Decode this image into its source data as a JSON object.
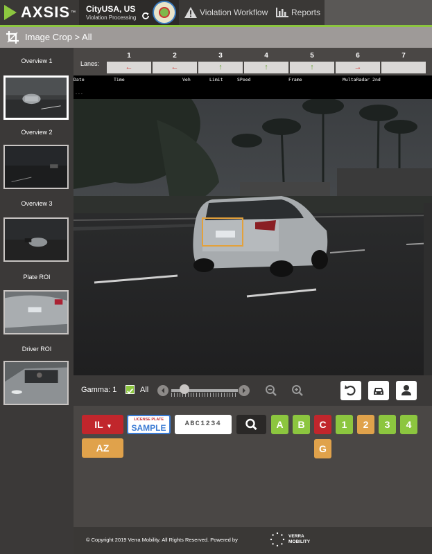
{
  "header": {
    "logo_text": "AXSIS",
    "logo_tm": "™",
    "city": "CityUSA, US",
    "city_sub": "Violation Processing",
    "nav": [
      {
        "label": "Violation Workflow",
        "icon": "warning-icon"
      },
      {
        "label": "Reports",
        "icon": "bar-chart-icon"
      }
    ]
  },
  "subheader": {
    "title": "Image Crop > All",
    "icon": "crop-icon"
  },
  "sidebar": {
    "thumbnails": [
      {
        "label": "Overview 1",
        "selected": true
      },
      {
        "label": "Overview 2",
        "selected": false
      },
      {
        "label": "Overview 3",
        "selected": false
      },
      {
        "label": "Plate ROI",
        "selected": false
      },
      {
        "label": "Driver ROI",
        "selected": false
      }
    ]
  },
  "lanes": {
    "label": "Lanes:",
    "items": [
      {
        "num": "1",
        "arrow": "←",
        "color": "#d0302b"
      },
      {
        "num": "2",
        "arrow": "←",
        "color": "#d0302b"
      },
      {
        "num": "3",
        "arrow": "↑",
        "color": "#6aa336"
      },
      {
        "num": "4",
        "arrow": "↑",
        "color": "#6aa336"
      },
      {
        "num": "5",
        "arrow": "↑",
        "color": "#6aa336"
      },
      {
        "num": "6",
        "arrow": "→",
        "color": "#d0302b"
      },
      {
        "num": "7",
        "arrow": "",
        "color": ""
      }
    ]
  },
  "data_strip": {
    "headers": [
      "Date",
      "Time",
      "Veh",
      "Limit",
      "SPeed",
      "Frame",
      "MultaRadar 2nd"
    ],
    "dash": "---"
  },
  "controls": {
    "gamma_label": "Gamma: 1",
    "all_label": "All",
    "all_checked": true,
    "gamma_level": 0.2
  },
  "plate": {
    "state": "IL",
    "sample_top": "LICENSE PLATE",
    "sample_main": "SAMPLE",
    "plate_value": "ABC1234",
    "candidates_row1": [
      {
        "label": "A",
        "color": "green"
      },
      {
        "label": "B",
        "color": "green"
      },
      {
        "label": "C",
        "color": "red"
      },
      {
        "label": "1",
        "color": "green"
      },
      {
        "label": "2",
        "color": "orange"
      },
      {
        "label": "3",
        "color": "green"
      },
      {
        "label": "4",
        "color": "green"
      }
    ],
    "candidates_row2": [
      {
        "label": "G",
        "color": "orange"
      }
    ],
    "alt_state": "AZ"
  },
  "footer": {
    "text": "© Copyright 2019 Verra Mobility. All Rights Reserved. Powered by",
    "brand_line1": "VERRA",
    "brand_line2": "MOBILITY"
  },
  "colors": {
    "accent_green": "#8cc63f",
    "danger_red": "#c1262c",
    "warn_orange": "#e0a24b"
  }
}
